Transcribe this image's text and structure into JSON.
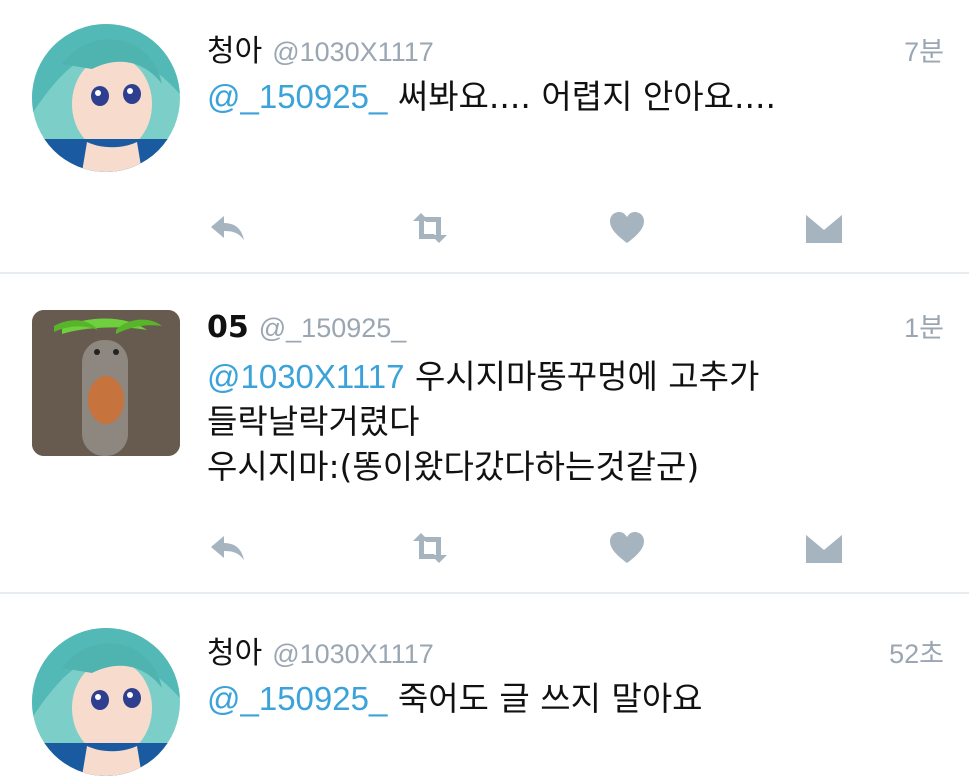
{
  "tweets": [
    {
      "name": "청아",
      "handle": "@1030X1117",
      "time": "7분",
      "mention": "@_150925_",
      "lines": [
        "써봐요.... 어렵지 안아요...."
      ]
    },
    {
      "name": "05",
      "handle": "@_150925_",
      "time": "1분",
      "mention": "@1030X1117",
      "lines": [
        "우시지마똥꾸멍에 고추가",
        "들락날락거렸다",
        "우시지마:(똥이왔다갔다하는것같군)"
      ]
    },
    {
      "name": "청아",
      "handle": "@1030X1117",
      "time": "52초",
      "mention": "@_150925_",
      "lines": [
        "죽어도 글 쓰지 말아요"
      ]
    }
  ],
  "icons": {
    "reply": "reply-icon",
    "retweet": "retweet-icon",
    "like": "heart-icon",
    "dm": "direct-message-icon"
  },
  "colors": {
    "mention": "#3ba3d9",
    "meta": "#9aa6b2",
    "action": "#a6b4c0",
    "divider": "#e6ecf0"
  }
}
